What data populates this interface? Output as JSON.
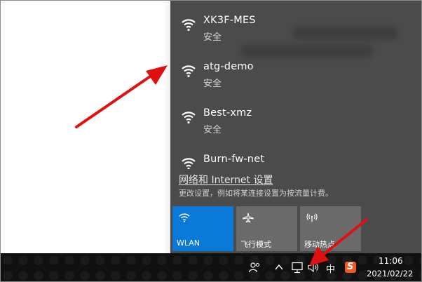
{
  "networks": [
    {
      "ssid": "XK3F-MES",
      "status": "安全"
    },
    {
      "ssid": "atg-demo",
      "status": "安全"
    },
    {
      "ssid": "Best-xmz",
      "status": "安全"
    },
    {
      "ssid": "Burn-fw-net",
      "status": ""
    }
  ],
  "settings": {
    "link_label": "网络和 Internet 设置",
    "description": "更改设置，例如将某连接设置为按流量计费。"
  },
  "quick_actions": [
    {
      "label": "WLAN",
      "icon": "wifi-icon",
      "active": true
    },
    {
      "label": "飞行模式",
      "icon": "airplane-icon",
      "active": false
    },
    {
      "label": "移动热点",
      "icon": "hotspot-icon",
      "active": false
    }
  ],
  "taskbar": {
    "ime_label": "中",
    "sogou_label": "S",
    "time": "11:06",
    "date": "2021/02/22"
  },
  "colors": {
    "flyout_bg": "#4b4b4b",
    "active_tile": "#0b79d8",
    "inactive_tile": "#6a6a6a",
    "annotation_arrow": "#e01010",
    "sogou": "#f05a22"
  }
}
